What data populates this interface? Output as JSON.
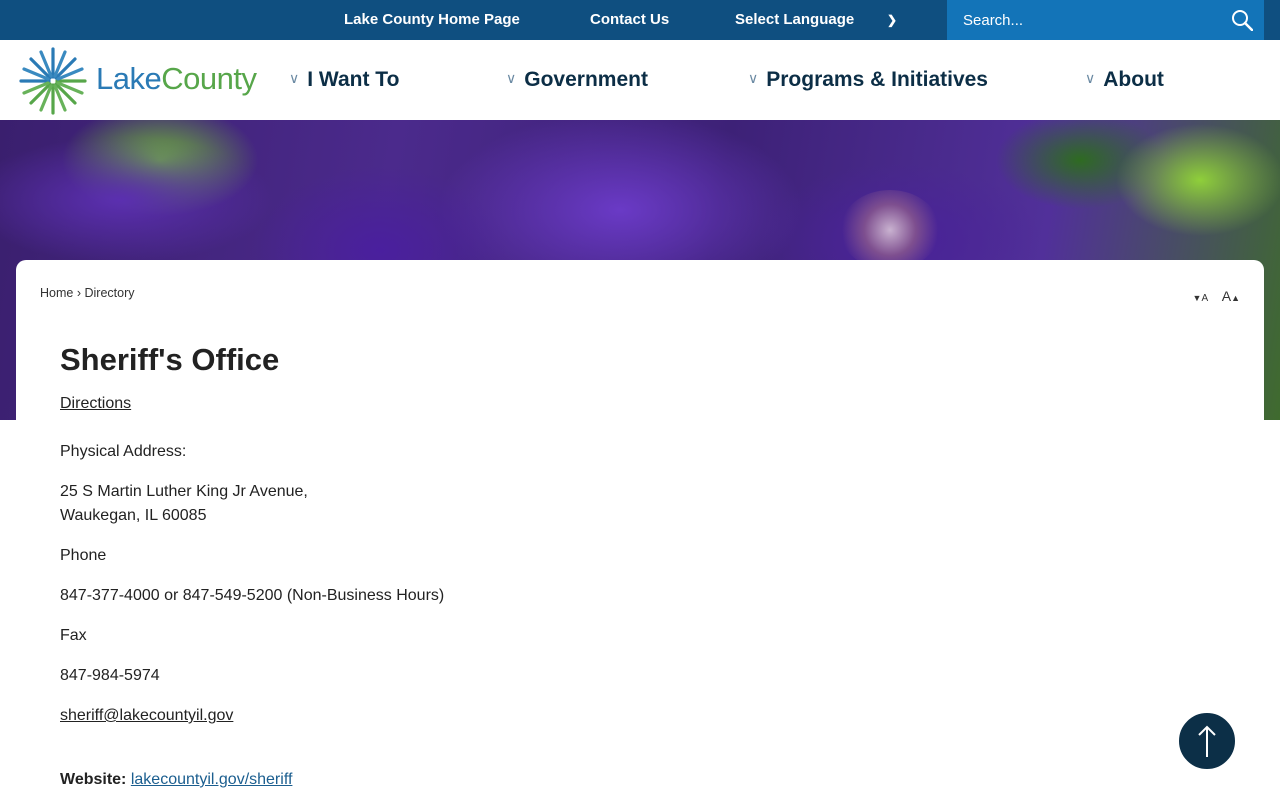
{
  "topbar": {
    "home_link": "Lake County Home Page",
    "contact_link": "Contact Us",
    "language_label": "Select Language",
    "search_placeholder": "Search..."
  },
  "logo": {
    "part1": "Lake",
    "part2": "County"
  },
  "nav": [
    {
      "label": "I Want To"
    },
    {
      "label": "Government"
    },
    {
      "label": "Programs & Initiatives"
    },
    {
      "label": "About"
    }
  ],
  "breadcrumb": {
    "home": "Home",
    "separator": "›",
    "current": "Directory"
  },
  "text_resize": {
    "decrease": "A",
    "increase": "A"
  },
  "content": {
    "title": "Sheriff's Office",
    "directions_link": "Directions",
    "physical_address_label": "Physical Address:",
    "address_line1": "25 S Martin Luther King Jr Avenue,",
    "address_line2": "Waukegan, IL 60085",
    "phone_label": "Phone",
    "phone_value": "847-377-4000 or 847-549-5200 (Non-Business Hours)",
    "fax_label": "Fax",
    "fax_value": "847-984-5974",
    "email": "sheriff@lakecountyil.gov",
    "website_label": "Website:",
    "website_link": "lakecountyil.gov/sheriff"
  },
  "colors": {
    "topbar": "#0f4f80",
    "search_bg": "#1374b8",
    "nav_text": "#0c2e46",
    "link": "#1b5e8f",
    "logo_blue": "#2a7ab5",
    "logo_green": "#57a64a"
  }
}
